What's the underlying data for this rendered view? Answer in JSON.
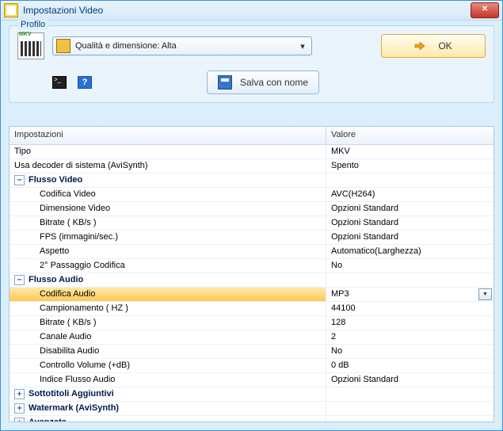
{
  "window": {
    "title": "Impostazioni Video",
    "close_label": "✕"
  },
  "profile": {
    "legend": "Profilo",
    "selected": "Qualità e dimensione: Alta",
    "ok_label": "OK",
    "save_label": "Salva con nome"
  },
  "grid": {
    "header_settings": "Impostazioni",
    "header_value": "Valore"
  },
  "rows": {
    "tipo": {
      "label": "Tipo",
      "value": "MKV"
    },
    "sysdec": {
      "label": "Usa decoder di sistema (AviSynth)",
      "value": "Spento"
    },
    "flusso_video": {
      "label": "Flusso Video"
    },
    "vcodec": {
      "label": "Codifica Video",
      "value": "AVC(H264)"
    },
    "vdim": {
      "label": "Dimensione Video",
      "value": "Opzioni Standard"
    },
    "vbitrate": {
      "label": "Bitrate ( KB/s )",
      "value": "Opzioni Standard"
    },
    "vfps": {
      "label": "FPS (immagini/sec.)",
      "value": "Opzioni Standard"
    },
    "vaspect": {
      "label": "Aspetto",
      "value": "Automatico(Larghezza)"
    },
    "vpass2": {
      "label": "2° Passaggio Codifica",
      "value": "No"
    },
    "flusso_audio": {
      "label": "Flusso Audio"
    },
    "acodec": {
      "label": "Codifica Audio",
      "value": "MP3"
    },
    "asamp": {
      "label": "Campionamento ( HZ )",
      "value": "44100"
    },
    "abitrate": {
      "label": "Bitrate ( KB/s )",
      "value": "128"
    },
    "achan": {
      "label": "Canale Audio",
      "value": "2"
    },
    "adisab": {
      "label": "Disabilita Audio",
      "value": "No"
    },
    "avol": {
      "label": "Controllo Volume (+dB)",
      "value": "0 dB"
    },
    "aindex": {
      "label": "Indice Flusso Audio",
      "value": "Opzioni Standard"
    },
    "subs": {
      "label": "Sottotitoli Aggiuntivi"
    },
    "watermark": {
      "label": "Watermark (AviSynth)"
    },
    "advanced": {
      "label": "Avanzata"
    }
  }
}
